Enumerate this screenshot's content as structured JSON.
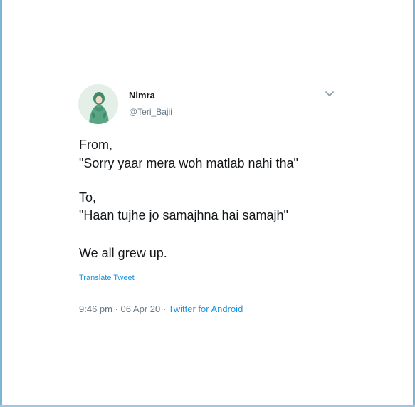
{
  "tweet": {
    "display_name": "Nimra",
    "handle": "@Teri_Bajii",
    "lines": [
      "From,",
      "\"Sorry yaar mera woh matlab nahi tha\"",
      "To,",
      "\"Haan tujhe jo samajhna hai samajh\"",
      "We all grew up."
    ],
    "translate_label": "Translate Tweet",
    "time": "9:46 pm",
    "date": "06 Apr 20",
    "source": "Twitter for Android",
    "separator": " · "
  },
  "icons": {
    "menu": "chevron-down-icon",
    "avatar": "profile-avatar"
  },
  "colors": {
    "text": "#14171a",
    "secondary": "#657786",
    "link": "#1b95e0",
    "avatar_bg": "#e3efe7",
    "avatar_figure": "#4f9a7a",
    "frame": "#7ab6d1"
  }
}
